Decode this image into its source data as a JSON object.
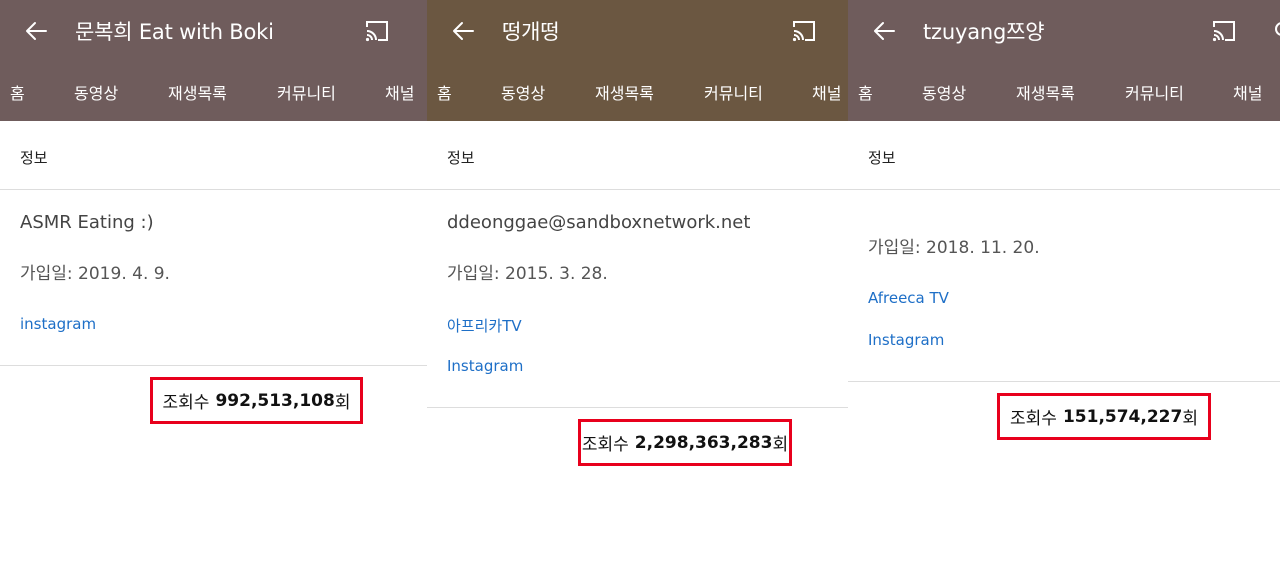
{
  "colors": {
    "header_channel1": "#6f5c5c",
    "header_channel2": "#6b5741",
    "header_channel3": "#6f5c5c",
    "link": "#1e6fc7",
    "highlight_box": "#e8001c"
  },
  "icons": [
    "back-arrow-icon",
    "cast-icon"
  ],
  "panels": [
    {
      "title": "문복희 Eat with Boki",
      "tabs": [
        "홈",
        "동영상",
        "재생목록",
        "커뮤니티",
        "채널"
      ],
      "about_heading": "정보",
      "description": "ASMR Eating :)",
      "joined": "가입일: 2019. 4. 9.",
      "links": [
        "instagram"
      ],
      "views": {
        "label": "조회수",
        "count": "992,513,108",
        "suffix": "회"
      }
    },
    {
      "title": "떵개떵",
      "tabs": [
        "홈",
        "동영상",
        "재생목록",
        "커뮤니티",
        "채널"
      ],
      "about_heading": "정보",
      "description": "ddeonggae@sandboxnetwork.net",
      "joined": "가입일: 2015. 3. 28.",
      "links": [
        "아프리카TV",
        "Instagram"
      ],
      "views": {
        "label": "조회수",
        "count": "2,298,363,283",
        "suffix": "회"
      }
    },
    {
      "title": "tzuyang쯔양",
      "tabs": [
        "홈",
        "동영상",
        "재생목록",
        "커뮤니티",
        "채널"
      ],
      "about_heading": "정보",
      "joined": "가입일: 2018. 11. 20.",
      "links": [
        "Afreeca TV",
        "Instagram"
      ],
      "views": {
        "label": "조회수",
        "count": "151,574,227",
        "suffix": "회"
      }
    }
  ]
}
